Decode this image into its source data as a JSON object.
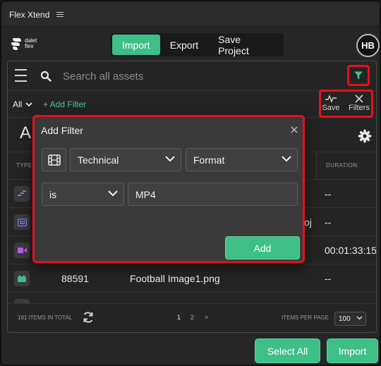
{
  "app": {
    "title": "Flex Xtend"
  },
  "logo": {
    "text_line1": "dalet",
    "text_line2": "flex"
  },
  "nav": {
    "tabs": [
      {
        "label": "Import",
        "active": true
      },
      {
        "label": "Export",
        "active": false
      },
      {
        "label": "Save Project",
        "active": false
      }
    ]
  },
  "user": {
    "initials": "HB"
  },
  "search": {
    "placeholder": "Search all assets",
    "value": ""
  },
  "filterbar": {
    "scope": "All",
    "add_filter": "+ Add Filter",
    "save_label": "Save",
    "filters_label": "Filters"
  },
  "assets": {
    "heading": "A"
  },
  "table": {
    "headers": {
      "type": "TYPE",
      "duration": "DURATION"
    },
    "rows": [
      {
        "type": "sequence",
        "id": "",
        "name": "",
        "duration": "--"
      },
      {
        "type": "image-sequence",
        "id": "",
        "name": "oj",
        "duration": "--"
      },
      {
        "type": "video",
        "id": "",
        "name": "",
        "duration": "00:01:33:15"
      },
      {
        "type": "image",
        "id": "88591",
        "name": "Football Image1.png",
        "duration": "--"
      },
      {
        "type": "file",
        "id": "",
        "name": "",
        "duration": ""
      }
    ]
  },
  "footer": {
    "total": "181 ITEMS IN TOTAL",
    "pages": [
      "1",
      "2",
      ">"
    ],
    "items_per_page_label": "ITEMS PER PAGE",
    "items_per_page": "100"
  },
  "modal": {
    "title": "Add Filter",
    "category": "Technical",
    "field": "Format",
    "operator": "is",
    "value": "MP4",
    "add_label": "Add"
  },
  "actions": {
    "select_all": "Select All",
    "import": "Import"
  },
  "colors": {
    "accent": "#3fbf88",
    "highlight": "#e3101b",
    "background": "#262626"
  }
}
